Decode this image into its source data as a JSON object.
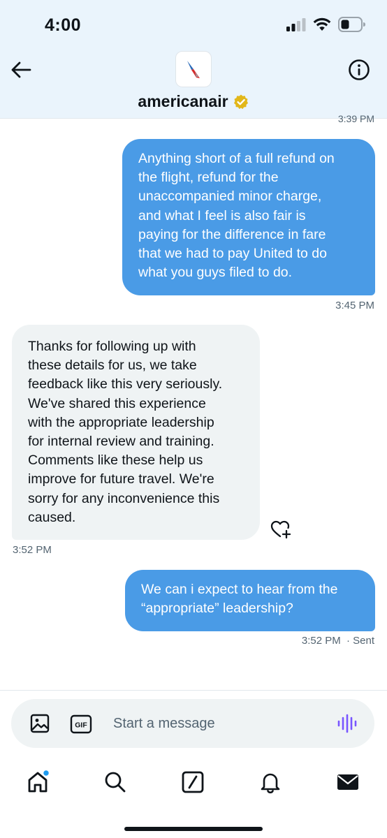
{
  "status_bar": {
    "time": "4:00"
  },
  "header": {
    "account_name": "americanair"
  },
  "thread": {
    "cut_off_timestamp": "3:39 PM",
    "messages": [
      {
        "direction": "outgoing",
        "lines": [
          "Anything short of a full refund on",
          "the flight, refund for the",
          "unaccompanied minor charge,",
          "and what I feel is also fair is",
          "paying for the difference in fare",
          "that we had to pay United to do",
          "what you guys filed to do."
        ],
        "timestamp": "3:45 PM"
      },
      {
        "direction": "incoming",
        "lines": [
          "Thanks for following up with",
          "these details for us, we take",
          "feedback like this very seriously.",
          "We've shared this experience",
          "with the appropriate leadership",
          "for internal review and training.",
          "Comments like these help us",
          "improve for future travel. We're",
          "sorry for any inconvenience this",
          "caused."
        ],
        "timestamp": "3:52 PM"
      },
      {
        "direction": "outgoing",
        "lines": [
          "We can i expect to hear from the",
          "“appropriate” leadership?"
        ],
        "timestamp": "3:52 PM",
        "status": "· Sent"
      }
    ]
  },
  "composer": {
    "placeholder": "Start a message",
    "gif_label": "GIF"
  },
  "icons": {
    "back": "arrow-left-icon",
    "info": "info-icon",
    "verified": "verified-badge-icon",
    "image": "image-icon",
    "gif": "gif-icon",
    "voice": "voice-waveform-icon",
    "like": "heart-plus-icon",
    "home": "home-icon",
    "search": "search-icon",
    "compose": "compose-icon",
    "notifications": "bell-icon",
    "messages": "envelope-icon"
  },
  "colors": {
    "outgoing_bubble": "#4a9be6",
    "incoming_bubble": "#eff3f4",
    "verified_gold": "#e2b719",
    "voice_purple": "#7856ff",
    "header_bg": "#eaf4fc",
    "notification_dot": "#1d9bf0"
  }
}
